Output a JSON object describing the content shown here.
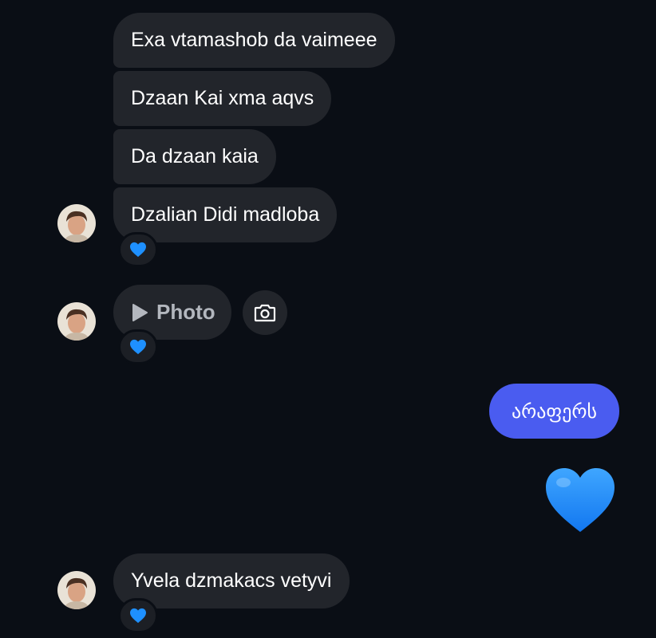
{
  "thread": {
    "group1": [
      {
        "text": "Exa vtamashob da vaimeee"
      },
      {
        "text": "Dzaan Kai xma aqvs"
      },
      {
        "text": "Da dzaan kaia"
      },
      {
        "text": "Dzalian Didi madloba"
      }
    ],
    "photo_label": "Photo",
    "outgoing_text": "არაფერს",
    "last_message": "Yvela dzmakacs vetyvi"
  },
  "reaction": {
    "emoji": "blue-heart",
    "color": "#1e90ff"
  },
  "colors": {
    "background": "#0a0e15",
    "incoming_bubble": "#22252b",
    "outgoing_bubble": "#4a5cf0",
    "heart": "#1e90ff"
  }
}
